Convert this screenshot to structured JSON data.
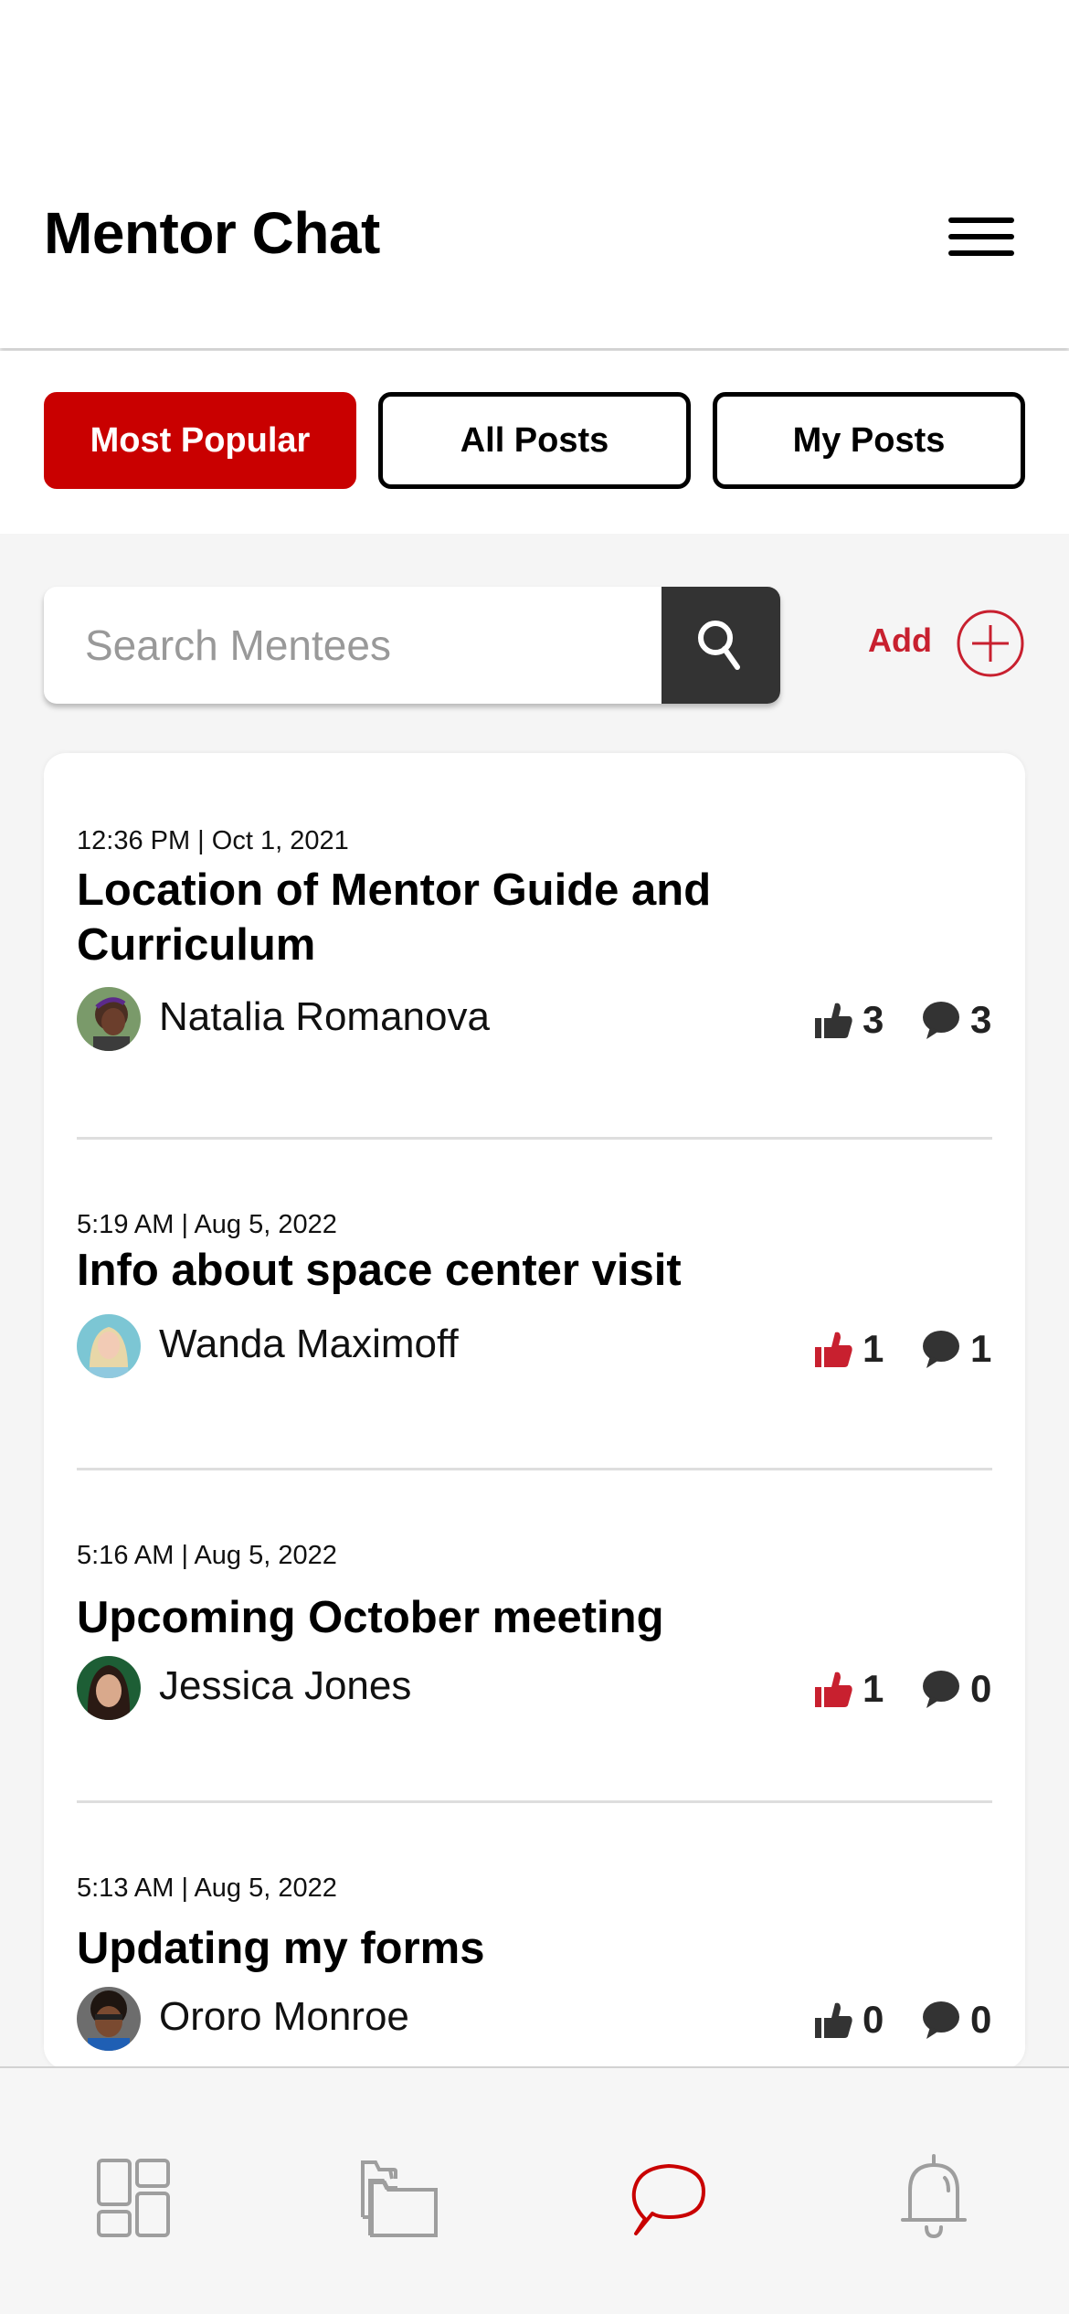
{
  "header": {
    "title": "Mentor Chat",
    "menu_icon": "hamburger-menu-icon"
  },
  "tabs": [
    {
      "label": "Most Popular",
      "active": true
    },
    {
      "label": "All Posts",
      "active": false
    },
    {
      "label": "My Posts",
      "active": false
    }
  ],
  "search": {
    "placeholder": "Search Mentees",
    "value": "",
    "button_icon": "search-icon"
  },
  "add": {
    "label": "Add",
    "icon": "plus-circle-icon"
  },
  "colors": {
    "accent": "#c90000",
    "liked": "#c8202f",
    "dark": "#333333",
    "inactive_icon": "#9e9e9e"
  },
  "posts": [
    {
      "timestamp": "12:36 PM | Oct 1, 2021",
      "title": "Location of Mentor Guide and Curriculum",
      "author": "Natalia Romanova",
      "likes": "3",
      "comments": "3",
      "liked": false
    },
    {
      "timestamp": "5:19 AM | Aug 5, 2022",
      "title": "Info about space center visit",
      "author": "Wanda Maximoff",
      "likes": "1",
      "comments": "1",
      "liked": true
    },
    {
      "timestamp": "5:16 AM | Aug 5, 2022",
      "title": "Upcoming October meeting",
      "author": "Jessica Jones",
      "likes": "1",
      "comments": "0",
      "liked": true
    },
    {
      "timestamp": "5:13 AM | Aug 5, 2022",
      "title": "Updating my forms",
      "author": "Ororo Monroe",
      "likes": "0",
      "comments": "0",
      "liked": false
    }
  ],
  "bottom_nav": [
    {
      "icon": "dashboard-icon",
      "active": false
    },
    {
      "icon": "folders-icon",
      "active": false
    },
    {
      "icon": "chat-icon",
      "active": true
    },
    {
      "icon": "bell-icon",
      "active": false
    }
  ]
}
